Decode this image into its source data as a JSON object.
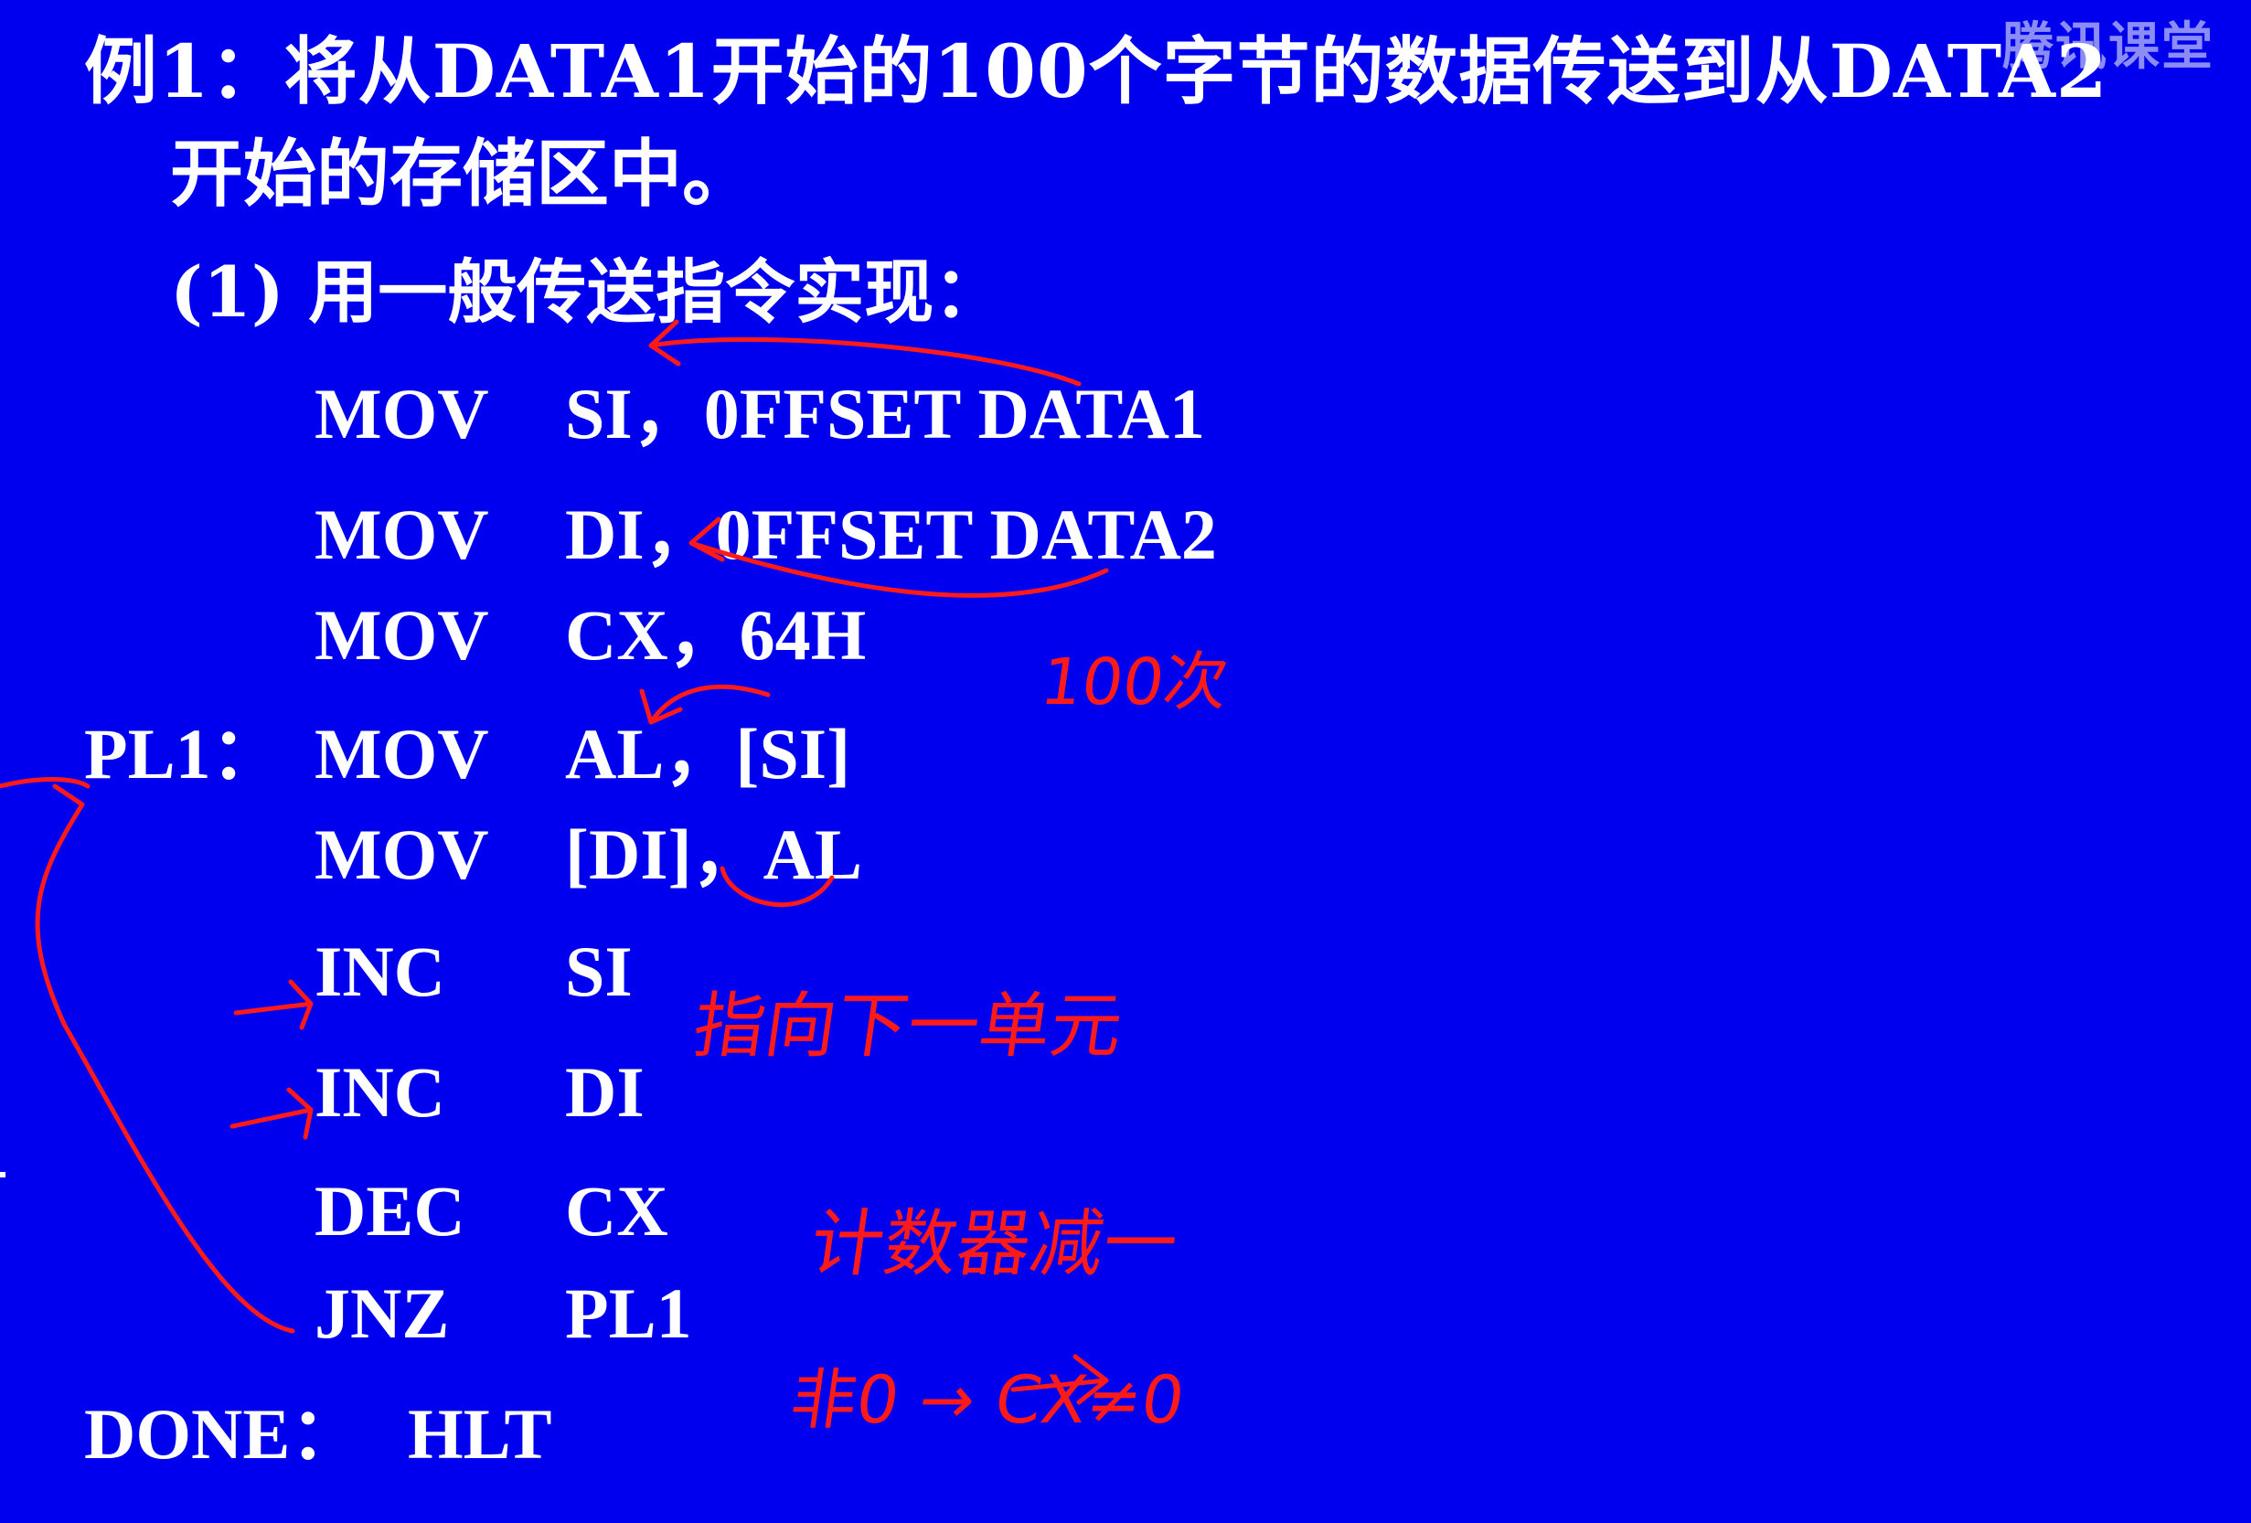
{
  "slide": {
    "title_line1": "例1：将从DATA1开始的100个字节的数据传送到从DATA2",
    "title_line2": "开始的存储区中。",
    "subtitle": "(1)   用一般传送指令实现：",
    "watermark": "腾讯课堂"
  },
  "code": [
    {
      "label": "",
      "op": "MOV",
      "arg": "SI，0FFSET  DATA1"
    },
    {
      "label": "",
      "op": "MOV",
      "arg": "DI，0FFSET  DATA2"
    },
    {
      "label": "",
      "op": "MOV",
      "arg": "CX，64H"
    },
    {
      "label": "PL1：",
      "op": "MOV",
      "arg": "AL，[SI]"
    },
    {
      "label": "",
      "op": "MOV",
      "arg": "[DI]，AL"
    },
    {
      "label": "",
      "op": "INC",
      "arg": "SI"
    },
    {
      "label": "",
      "op": "INC",
      "arg": "DI"
    },
    {
      "label": "",
      "op": "DEC",
      "arg": "CX"
    },
    {
      "label": "",
      "op": "JNZ",
      "arg": "PL1"
    },
    {
      "label": "DONE：",
      "op": "HLT",
      "arg": ""
    }
  ],
  "annotations": {
    "count_note": "100次",
    "pointer_note": "指向下一单元",
    "counter_note": "计数器减一",
    "nonzero_note": "非0 → CX≠0"
  },
  "colors": {
    "background": "#0000ee",
    "text": "#ffffff",
    "ink": "#ff1a1a"
  }
}
